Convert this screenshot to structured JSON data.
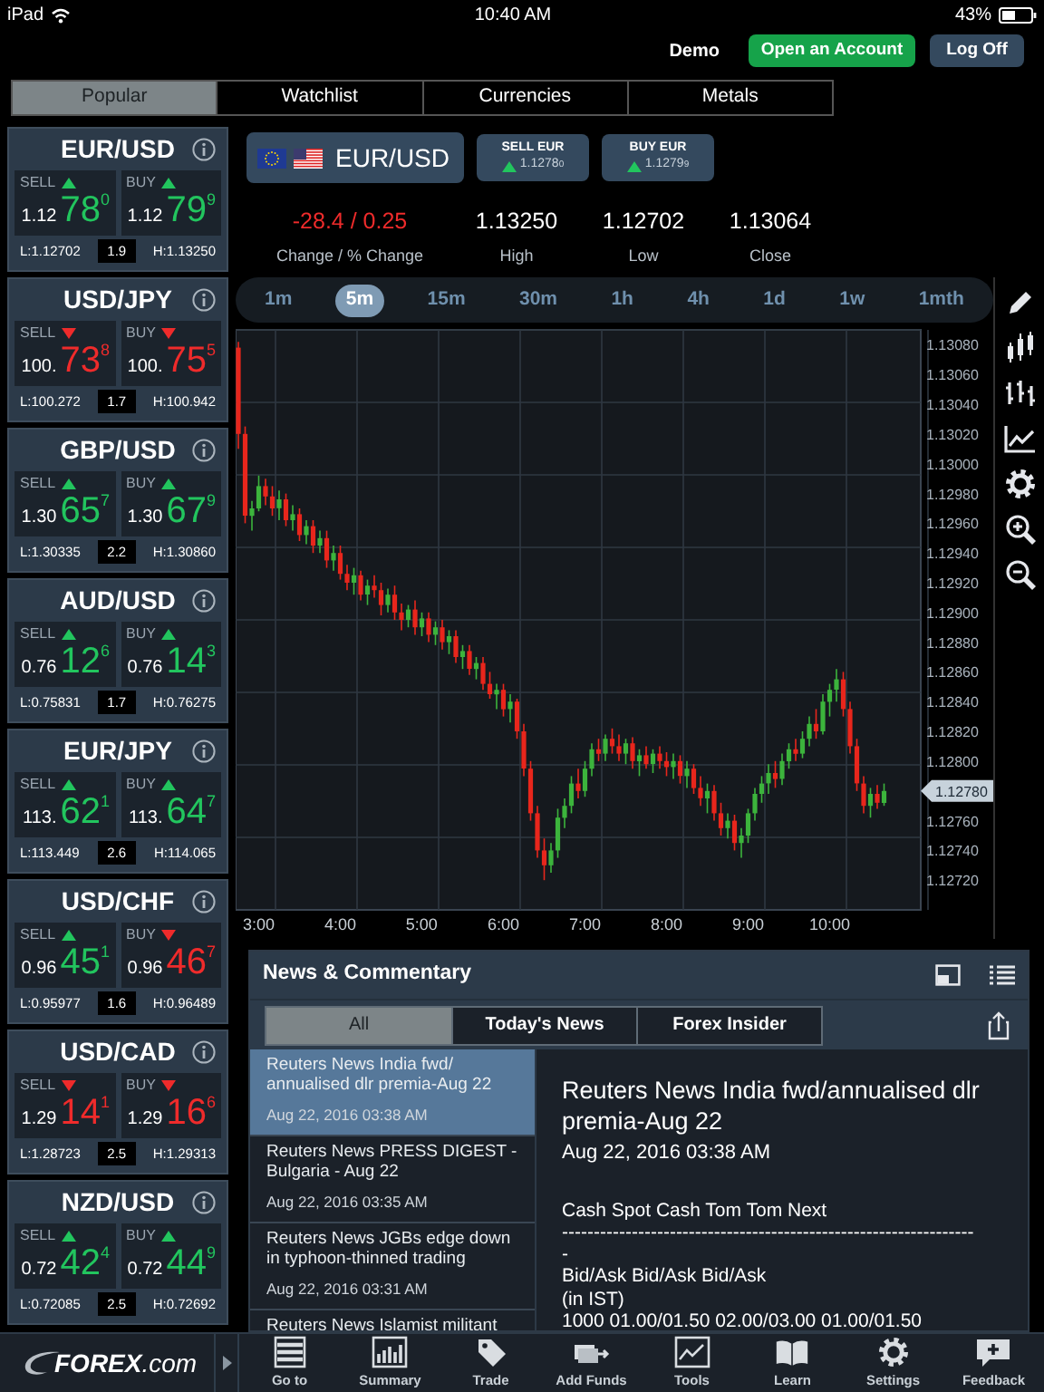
{
  "status_bar": {
    "device": "iPad",
    "time": "10:40 AM",
    "battery": "43%"
  },
  "account": {
    "mode": "Demo",
    "buttons": [
      {
        "label": "Open an Account",
        "kind": "primary"
      },
      {
        "label": "Log Off",
        "kind": "secondary"
      }
    ]
  },
  "tabs": [
    {
      "label": "Popular",
      "selected": true
    },
    {
      "label": "Watchlist",
      "selected": false
    },
    {
      "label": "Currencies",
      "selected": false
    },
    {
      "label": "Metals",
      "selected": false
    }
  ],
  "quotes": [
    {
      "pair": "EUR/USD",
      "sell": {
        "label": "SELL",
        "rising": true,
        "prefix": "1.12",
        "pips": "78",
        "fraction": "0"
      },
      "buy": {
        "label": "BUY",
        "rising": true,
        "prefix": "1.12",
        "pips": "79",
        "fraction": "9"
      },
      "low": "L:1.12702",
      "spread": "1.9",
      "high": "H:1.13250"
    },
    {
      "pair": "USD/JPY",
      "sell": {
        "label": "SELL",
        "rising": false,
        "prefix": "100.",
        "pips": "73",
        "fraction": "8"
      },
      "buy": {
        "label": "BUY",
        "rising": false,
        "prefix": "100.",
        "pips": "75",
        "fraction": "5"
      },
      "low": "L:100.272",
      "spread": "1.7",
      "high": "H:100.942"
    },
    {
      "pair": "GBP/USD",
      "sell": {
        "label": "SELL",
        "rising": true,
        "prefix": "1.30",
        "pips": "65",
        "fraction": "7"
      },
      "buy": {
        "label": "BUY",
        "rising": true,
        "prefix": "1.30",
        "pips": "67",
        "fraction": "9"
      },
      "low": "L:1.30335",
      "spread": "2.2",
      "high": "H:1.30860"
    },
    {
      "pair": "AUD/USD",
      "sell": {
        "label": "SELL",
        "rising": true,
        "prefix": "0.76",
        "pips": "12",
        "fraction": "6"
      },
      "buy": {
        "label": "BUY",
        "rising": true,
        "prefix": "0.76",
        "pips": "14",
        "fraction": "3"
      },
      "low": "L:0.75831",
      "spread": "1.7",
      "high": "H:0.76275"
    },
    {
      "pair": "EUR/JPY",
      "sell": {
        "label": "SELL",
        "rising": true,
        "prefix": "113.",
        "pips": "62",
        "fraction": "1"
      },
      "buy": {
        "label": "BUY",
        "rising": true,
        "prefix": "113.",
        "pips": "64",
        "fraction": "7"
      },
      "low": "L:113.449",
      "spread": "2.6",
      "high": "H:114.065"
    },
    {
      "pair": "USD/CHF",
      "sell": {
        "label": "SELL",
        "rising": true,
        "prefix": "0.96",
        "pips": "45",
        "fraction": "1"
      },
      "buy": {
        "label": "BUY",
        "rising": false,
        "prefix": "0.96",
        "pips": "46",
        "fraction": "7"
      },
      "low": "L:0.95977",
      "spread": "1.6",
      "high": "H:0.96489"
    },
    {
      "pair": "USD/CAD",
      "sell": {
        "label": "SELL",
        "rising": false,
        "prefix": "1.29",
        "pips": "14",
        "fraction": "1"
      },
      "buy": {
        "label": "BUY",
        "rising": false,
        "prefix": "1.29",
        "pips": "16",
        "fraction": "6"
      },
      "low": "L:1.28723",
      "spread": "2.5",
      "high": "H:1.29313"
    },
    {
      "pair": "NZD/USD",
      "sell": {
        "label": "SELL",
        "rising": true,
        "prefix": "0.72",
        "pips": "42",
        "fraction": "4"
      },
      "buy": {
        "label": "BUY",
        "rising": true,
        "prefix": "0.72",
        "pips": "44",
        "fraction": "9"
      },
      "low": "L:0.72085",
      "spread": "2.5",
      "high": "H:0.72692"
    }
  ],
  "instrument": {
    "pair": "EUR/USD",
    "sell": {
      "label": "SELL EUR",
      "rising": true,
      "price": "1.1278",
      "fraction": "0"
    },
    "buy": {
      "label": "BUY EUR",
      "rising": true,
      "price": "1.1279",
      "fraction": "9"
    }
  },
  "stats": [
    {
      "value": "-28.4 / 0.25",
      "label": "Change / % Change",
      "negative": true
    },
    {
      "value": "1.13250",
      "label": "High",
      "negative": false
    },
    {
      "value": "1.12702",
      "label": "Low",
      "negative": false
    },
    {
      "value": "1.13064",
      "label": "Close",
      "negative": false
    }
  ],
  "timeframes": [
    {
      "label": "1m",
      "selected": false
    },
    {
      "label": "5m",
      "selected": true
    },
    {
      "label": "15m",
      "selected": false
    },
    {
      "label": "30m",
      "selected": false
    },
    {
      "label": "1h",
      "selected": false
    },
    {
      "label": "4h",
      "selected": false
    },
    {
      "label": "1d",
      "selected": false
    },
    {
      "label": "1w",
      "selected": false
    },
    {
      "label": "1mth",
      "selected": false
    }
  ],
  "chart_tools": [
    {
      "kind": "pencil"
    },
    {
      "kind": "candles"
    },
    {
      "kind": "bars"
    },
    {
      "kind": "line"
    },
    {
      "kind": "settings"
    },
    {
      "kind": "zoom_in"
    },
    {
      "kind": "zoom_out"
    }
  ],
  "chart": {
    "current_price": "1.12780",
    "chart_data": {
      "type": "candlestick",
      "x": [
        165,
        170,
        175,
        180,
        185,
        190,
        195,
        200,
        205,
        210,
        215,
        220,
        225,
        230,
        235,
        240,
        245,
        250,
        255,
        260,
        265,
        270,
        275,
        280,
        285,
        290,
        295,
        300,
        305,
        310,
        315,
        320,
        325,
        330,
        335,
        340,
        345,
        350,
        355,
        360,
        365,
        370,
        375,
        380,
        385,
        390,
        395,
        400,
        405,
        410,
        415,
        420,
        425,
        430,
        435,
        440,
        445,
        450,
        455,
        460,
        465,
        470,
        475,
        480,
        485,
        490,
        495,
        500,
        505,
        510,
        515,
        520,
        525,
        530,
        535,
        540,
        545,
        550,
        555,
        560,
        565,
        570,
        575,
        580,
        585,
        590,
        595,
        600,
        605,
        610,
        615,
        620,
        625,
        630,
        635,
        640
      ],
      "ohlc": [
        [
          1.13078,
          1.13082,
          1.1301,
          1.1302
        ],
        [
          1.1302,
          1.13025,
          1.1296,
          1.12965
        ],
        [
          1.12965,
          1.12975,
          1.12955,
          1.1297
        ],
        [
          1.1297,
          1.12992,
          1.12968,
          1.12985
        ],
        [
          1.12985,
          1.1299,
          1.12972,
          1.12978
        ],
        [
          1.12978,
          1.12985,
          1.12965,
          1.1297
        ],
        [
          1.1297,
          1.12982,
          1.12962,
          1.12976
        ],
        [
          1.12976,
          1.1298,
          1.12958,
          1.12962
        ],
        [
          1.12962,
          1.12972,
          1.12955,
          1.12966
        ],
        [
          1.12966,
          1.1297,
          1.12948,
          1.12952
        ],
        [
          1.12952,
          1.12962,
          1.12946,
          1.12958
        ],
        [
          1.12958,
          1.12962,
          1.1294,
          1.12945
        ],
        [
          1.12945,
          1.12955,
          1.1294,
          1.1295
        ],
        [
          1.1295,
          1.12955,
          1.1293,
          1.12935
        ],
        [
          1.12935,
          1.12945,
          1.12928,
          1.1294
        ],
        [
          1.1294,
          1.12945,
          1.12922,
          1.12926
        ],
        [
          1.12926,
          1.12932,
          1.12915,
          1.1292
        ],
        [
          1.1292,
          1.1293,
          1.12912,
          1.12925
        ],
        [
          1.12925,
          1.12928,
          1.12908,
          1.12912
        ],
        [
          1.12912,
          1.12922,
          1.12905,
          1.12918
        ],
        [
          1.12918,
          1.12925,
          1.1291,
          1.12915
        ],
        [
          1.12915,
          1.1292,
          1.12898,
          1.12905
        ],
        [
          1.12905,
          1.12916,
          1.129,
          1.12912
        ],
        [
          1.12912,
          1.12918,
          1.12895,
          1.129
        ],
        [
          1.129,
          1.12906,
          1.12888,
          1.12895
        ],
        [
          1.12895,
          1.12905,
          1.1289,
          1.12902
        ],
        [
          1.12902,
          1.12908,
          1.12885,
          1.1289
        ],
        [
          1.1289,
          1.129,
          1.12884,
          1.12896
        ],
        [
          1.12896,
          1.129,
          1.1288,
          1.12885
        ],
        [
          1.12885,
          1.12894,
          1.12878,
          1.1289
        ],
        [
          1.1289,
          1.12895,
          1.12875,
          1.1288
        ],
        [
          1.1288,
          1.12888,
          1.12872,
          1.12884
        ],
        [
          1.12884,
          1.12888,
          1.12866,
          1.1287
        ],
        [
          1.1287,
          1.12878,
          1.12862,
          1.12874
        ],
        [
          1.12874,
          1.12878,
          1.12858,
          1.12862
        ],
        [
          1.12862,
          1.1287,
          1.12855,
          1.12866
        ],
        [
          1.12866,
          1.1287,
          1.12848,
          1.12852
        ],
        [
          1.12852,
          1.1286,
          1.12842,
          1.12845
        ],
        [
          1.12845,
          1.12852,
          1.12835,
          1.12848
        ],
        [
          1.12848,
          1.12852,
          1.1283,
          1.12835
        ],
        [
          1.12835,
          1.12845,
          1.12826,
          1.1284
        ],
        [
          1.1284,
          1.12842,
          1.12815,
          1.1282
        ],
        [
          1.1282,
          1.12825,
          1.1279,
          1.12795
        ],
        [
          1.12795,
          1.128,
          1.1276,
          1.12765
        ],
        [
          1.12765,
          1.1277,
          1.12735,
          1.1274
        ],
        [
          1.1274,
          1.12748,
          1.1272,
          1.1273
        ],
        [
          1.1273,
          1.12745,
          1.12725,
          1.1274
        ],
        [
          1.1274,
          1.12768,
          1.12735,
          1.12762
        ],
        [
          1.12762,
          1.12775,
          1.12755,
          1.1277
        ],
        [
          1.1277,
          1.1279,
          1.12765,
          1.12785
        ],
        [
          1.12785,
          1.12795,
          1.12775,
          1.1278
        ],
        [
          1.1278,
          1.128,
          1.12776,
          1.12795
        ],
        [
          1.12795,
          1.12812,
          1.1279,
          1.12808
        ],
        [
          1.12808,
          1.12815,
          1.128,
          1.12805
        ],
        [
          1.12805,
          1.12818,
          1.128,
          1.12815
        ],
        [
          1.12815,
          1.12822,
          1.12805,
          1.1281
        ],
        [
          1.1281,
          1.12818,
          1.128,
          1.12805
        ],
        [
          1.12805,
          1.12815,
          1.12798,
          1.12812
        ],
        [
          1.12812,
          1.12816,
          1.12795,
          1.128
        ],
        [
          1.128,
          1.12808,
          1.1279,
          1.12804
        ],
        [
          1.12804,
          1.1281,
          1.12795,
          1.12798
        ],
        [
          1.12798,
          1.12808,
          1.12792,
          1.12805
        ],
        [
          1.12805,
          1.1281,
          1.12795,
          1.128
        ],
        [
          1.128,
          1.12806,
          1.1279,
          1.12796
        ],
        [
          1.12796,
          1.12805,
          1.12788,
          1.128
        ],
        [
          1.128,
          1.12804,
          1.12785,
          1.1279
        ],
        [
          1.1279,
          1.128,
          1.12782,
          1.12795
        ],
        [
          1.12795,
          1.12798,
          1.12778,
          1.12782
        ],
        [
          1.12782,
          1.1279,
          1.1277,
          1.12775
        ],
        [
          1.12775,
          1.12785,
          1.12765,
          1.1278
        ],
        [
          1.1278,
          1.12784,
          1.1276,
          1.12765
        ],
        [
          1.12765,
          1.12772,
          1.1275,
          1.12755
        ],
        [
          1.12755,
          1.12765,
          1.12748,
          1.1276
        ],
        [
          1.1276,
          1.12764,
          1.1274,
          1.12745
        ],
        [
          1.12745,
          1.12755,
          1.12735,
          1.1275
        ],
        [
          1.1275,
          1.12768,
          1.12745,
          1.12765
        ],
        [
          1.12765,
          1.12782,
          1.1276,
          1.12778
        ],
        [
          1.12778,
          1.1279,
          1.12772,
          1.12785
        ],
        [
          1.12785,
          1.12798,
          1.12778,
          1.12792
        ],
        [
          1.12792,
          1.128,
          1.12782,
          1.12788
        ],
        [
          1.12788,
          1.12805,
          1.12784,
          1.128
        ],
        [
          1.128,
          1.12812,
          1.12795,
          1.12808
        ],
        [
          1.12808,
          1.12815,
          1.128,
          1.12805
        ],
        [
          1.12805,
          1.1282,
          1.12802,
          1.12815
        ],
        [
          1.12815,
          1.1283,
          1.1281,
          1.12825
        ],
        [
          1.12825,
          1.12835,
          1.12815,
          1.1282
        ],
        [
          1.1282,
          1.12845,
          1.12818,
          1.1284
        ],
        [
          1.1284,
          1.12852,
          1.1283,
          1.12848
        ],
        [
          1.12848,
          1.12862,
          1.1284,
          1.12855
        ],
        [
          1.12855,
          1.1286,
          1.1283,
          1.12835
        ],
        [
          1.12835,
          1.1284,
          1.12805,
          1.1281
        ],
        [
          1.1281,
          1.12815,
          1.1278,
          1.12785
        ],
        [
          1.12785,
          1.1279,
          1.12765,
          1.1277
        ],
        [
          1.1277,
          1.12782,
          1.12762,
          1.12778
        ],
        [
          1.12778,
          1.12784,
          1.12768,
          1.12772
        ],
        [
          1.12772,
          1.12785,
          1.1277,
          1.1278
        ]
      ],
      "xlim": [
        163,
        667
      ],
      "ylim": [
        1.127,
        1.1309
      ],
      "xticks": [
        {
          "value": 180,
          "label": "3:00"
        },
        {
          "value": 240,
          "label": "4:00"
        },
        {
          "value": 300,
          "label": "5:00"
        },
        {
          "value": 360,
          "label": "6:00"
        },
        {
          "value": 420,
          "label": "7:00"
        },
        {
          "value": 480,
          "label": "8:00"
        },
        {
          "value": 540,
          "label": "9:00"
        },
        {
          "value": 600,
          "label": "10:00"
        }
      ],
      "yticks": [
        {
          "value": 1.1308,
          "label": "1.13080"
        },
        {
          "value": 1.1306,
          "label": "1.13060"
        },
        {
          "value": 1.1304,
          "label": "1.13040"
        },
        {
          "value": 1.1302,
          "label": "1.13020"
        },
        {
          "value": 1.13,
          "label": "1.13000"
        },
        {
          "value": 1.1298,
          "label": "1.12980"
        },
        {
          "value": 1.1296,
          "label": "1.12960"
        },
        {
          "value": 1.1294,
          "label": "1.12940"
        },
        {
          "value": 1.1292,
          "label": "1.12920"
        },
        {
          "value": 1.129,
          "label": "1.12900"
        },
        {
          "value": 1.1288,
          "label": "1.12880"
        },
        {
          "value": 1.1286,
          "label": "1.12860"
        },
        {
          "value": 1.1284,
          "label": "1.12840"
        },
        {
          "value": 1.1282,
          "label": "1.12820"
        },
        {
          "value": 1.128,
          "label": "1.12800"
        },
        {
          "value": 1.1276,
          "label": "1.12760"
        },
        {
          "value": 1.1274,
          "label": "1.12740"
        },
        {
          "value": 1.1272,
          "label": "1.12720"
        }
      ]
    }
  },
  "news": {
    "title": "News & Commentary",
    "tabs": [
      {
        "label": "All",
        "selected": true
      },
      {
        "label": "Today's News",
        "selected": false
      },
      {
        "label": "Forex Insider",
        "selected": false
      }
    ],
    "items": [
      {
        "title": "Reuters News  India fwd/annualised dlr premia-Aug 22",
        "date": "Aug 22, 2016 03:38 AM",
        "selected": true
      },
      {
        "title": "Reuters News  PRESS DIGEST - Bulgaria - Aug 22",
        "date": "Aug 22, 2016 03:35 AM",
        "selected": false
      },
      {
        "title": "Reuters News  JGBs edge down in typhoon-thinned trading",
        "date": "Aug 22, 2016 03:31 AM",
        "selected": false
      },
      {
        "title": "Reuters News  Islamist militant",
        "selected": false
      }
    ],
    "detail": {
      "title": "Reuters News India fwd/annualised dlr premia-Aug 22",
      "date": "Aug 22, 2016 03:38 AM",
      "lines": [
        "Cash Spot Cash Tom Tom Next",
        "-----------------------------------------------------------------",
        "-",
        "Bid/Ask Bid/Ask Bid/Ask",
        "(in IST)",
        "1000 01.00/01.50 02.00/03.00 01.00/01.50"
      ]
    }
  },
  "bottom_bar": {
    "logo": "**FOREX**.com",
    "items": [
      {
        "label": "Go to",
        "kind": "goto"
      },
      {
        "label": "Summary",
        "kind": "summary"
      },
      {
        "label": "Trade",
        "kind": "trade"
      },
      {
        "label": "Add Funds",
        "kind": "funds"
      },
      {
        "label": "Tools",
        "kind": "tools"
      },
      {
        "label": "Learn",
        "kind": "learn"
      },
      {
        "label": "Settings",
        "kind": "settings"
      },
      {
        "label": "Feedback",
        "kind": "feedback"
      }
    ]
  }
}
